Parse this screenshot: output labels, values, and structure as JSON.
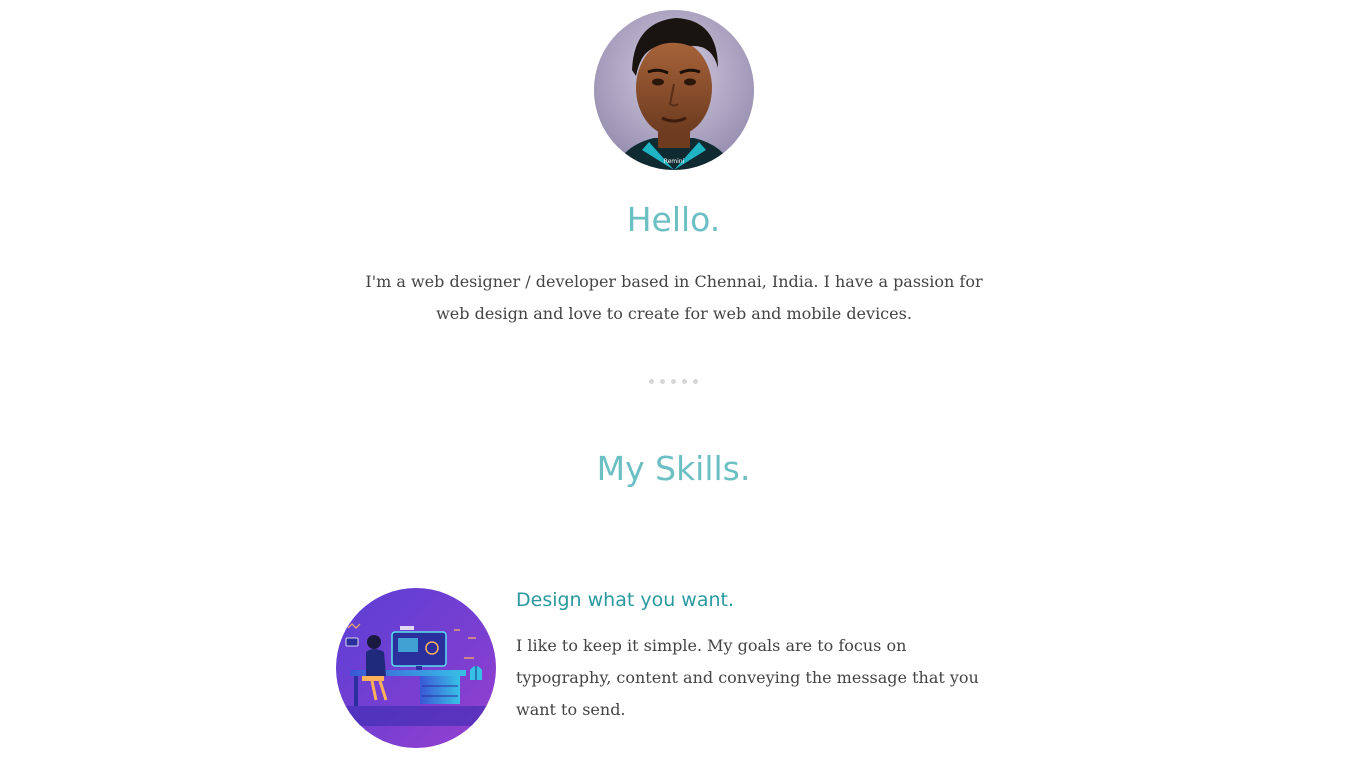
{
  "profile": {
    "avatar_icon": "profile-portrait",
    "avatar_mark": "Remini"
  },
  "hello": {
    "heading": "Hello.",
    "intro": "I'm a web designer / developer based in Chennai, India. I have a passion for web design and love to create for web and mobile devices."
  },
  "separator": {
    "dot_count": 5
  },
  "skills": {
    "heading": "My Skills.",
    "items": [
      {
        "image_icon": "designer-workspace-illustration",
        "title": "Design what you want.",
        "text": "I like to keep it simple. My goals are to focus on typography, content and conveying the message that you want to send."
      }
    ]
  },
  "colors": {
    "heading": "#6cbfc3",
    "skill_title": "#2a9a9e",
    "body_text": "#444444",
    "dots": "#d6d6d6"
  }
}
